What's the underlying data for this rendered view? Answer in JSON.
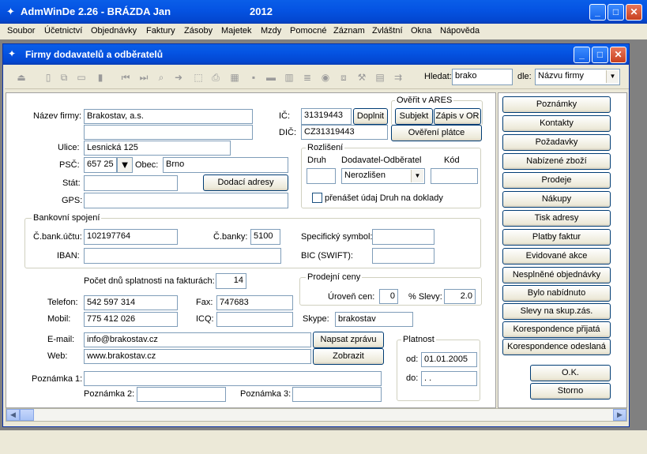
{
  "app": {
    "title": "AdmWinDe 2.26 - BRÁZDA Jan",
    "year": "2012"
  },
  "menu": [
    "Soubor",
    "Účetnictví",
    "Objednávky",
    "Faktury",
    "Zásoby",
    "Majetek",
    "Mzdy",
    "Pomocné",
    "Záznam",
    "Zvláštní",
    "Okna",
    "Nápověda"
  ],
  "window": {
    "title": "Firmy dodavatelů a odběratelů"
  },
  "toolbar": {
    "search_label": "Hledat:",
    "search_value": "brako",
    "by_label": "dle:",
    "by_value": "Názvu firmy"
  },
  "form": {
    "name_label": "Název firmy:",
    "name_value": "Brakostav, a.s.",
    "name2_value": "",
    "street_label": "Ulice:",
    "street_value": "Lesnická 125",
    "zip_label": "PSČ:",
    "zip_value": "657 25",
    "city_label": "Obec:",
    "city_value": "Brno",
    "country_label": "Stát:",
    "country_value": "",
    "delivery_btn": "Dodací adresy",
    "gps_label": "GPS:",
    "gps_value": "",
    "ic_label": "IČ:",
    "ic_value": "31319443",
    "doplnit_btn": "Doplnit",
    "dic_label": "DIČ:",
    "dic_value": "CZ31319443",
    "ares_legend": "Ověřit v ARES",
    "subjekt_btn": "Subjekt",
    "zapis_btn": "Zápis v OR",
    "overeni_btn": "Ověření plátce",
    "rozliseni_legend": "Rozlišení",
    "druh_label": "Druh",
    "druh_value": "",
    "dod_odb_label": "Dodavatel-Odběratel",
    "dod_odb_value": "Nerozlišen",
    "kod_label": "Kód",
    "kod_value": "",
    "prenaset_label": "přenášet údaj Druh na doklady",
    "bank_legend": "Bankovní spojení",
    "account_label": "Č.bank.účtu:",
    "account_value": "102197764",
    "bankno_label": "Č.banky:",
    "bankno_value": "5100",
    "specsym_label": "Specifický symbol:",
    "specsym_value": "",
    "iban_label": "IBAN:",
    "iban_value": "",
    "bic_label": "BIC (SWIFT):",
    "bic_value": "",
    "due_label": "Počet dnů splatnosti na fakturách:",
    "due_value": "14",
    "prices_legend": "Prodejní ceny",
    "level_label": "Úroveň cen:",
    "level_value": "0",
    "discount_label": "% Slevy:",
    "discount_value": "2.0",
    "phone_label": "Telefon:",
    "phone_value": "542 597 314",
    "fax_label": "Fax:",
    "fax_value": "747683",
    "mobile_label": "Mobil:",
    "mobile_value": "775 412 026",
    "icq_label": "ICQ:",
    "icq_value": "",
    "skype_label": "Skype:",
    "skype_value": "brakostav",
    "email_label": "E-mail:",
    "email_value": "info@brakostav.cz",
    "write_btn": "Napsat zprávu",
    "web_label": "Web:",
    "web_value": "www.brakostav.cz",
    "show_btn": "Zobrazit",
    "validity_legend": "Platnost",
    "from_label": "od:",
    "from_value": "01.01.2005",
    "to_label": "do:",
    "to_value": " .  .",
    "note1_label": "Poznámka 1:",
    "note1_value": "",
    "note2_label": "Poznámka 2:",
    "note2_value": "",
    "note3_label": "Poznámka 3:",
    "note3_value": ""
  },
  "side_buttons": [
    "Poznámky",
    "Kontakty",
    "Požadavky",
    "Nabízené zboží",
    "Prodeje",
    "Nákupy",
    "Tisk adresy",
    "Platby faktur",
    "Evidované akce",
    "Nesplněné objednávky",
    "Bylo nabídnuto",
    "Slevy na skup.zás.",
    "Korespondence přijatá",
    "Korespondence odeslaná"
  ],
  "dialog": {
    "ok": "O.K.",
    "cancel": "Storno"
  }
}
